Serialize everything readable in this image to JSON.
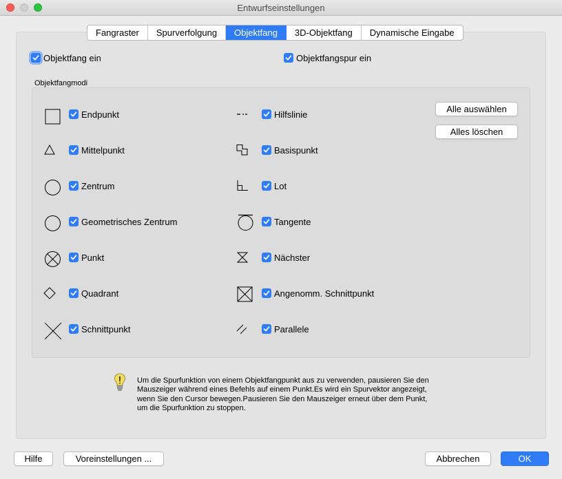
{
  "window": {
    "title": "Entwurfseinstellungen"
  },
  "tabs": [
    {
      "label": "Fangraster",
      "active": false
    },
    {
      "label": "Spurverfolgung",
      "active": false
    },
    {
      "label": "Objektfang",
      "active": true
    },
    {
      "label": "3D-Objektfang",
      "active": false
    },
    {
      "label": "Dynamische Eingabe",
      "active": false
    }
  ],
  "options": {
    "objektfang_ein": {
      "label": "Objektfang ein",
      "checked": true
    },
    "objektfangspur_ein": {
      "label": "Objektfangspur ein",
      "checked": true
    }
  },
  "modes": {
    "section_label": "Objektfangmodi",
    "left": [
      {
        "label": "Endpunkt",
        "icon": "endpoint-square-icon",
        "checked": true
      },
      {
        "label": "Mittelpunkt",
        "icon": "midpoint-triangle-icon",
        "checked": true
      },
      {
        "label": "Zentrum",
        "icon": "center-circle-icon",
        "checked": true
      },
      {
        "label": "Geometrisches Zentrum",
        "icon": "geometric-center-circle-icon",
        "checked": true
      },
      {
        "label": "Punkt",
        "icon": "node-point-icon",
        "checked": true
      },
      {
        "label": "Quadrant",
        "icon": "quadrant-diamond-icon",
        "checked": true
      },
      {
        "label": "Schnittpunkt",
        "icon": "intersection-x-icon",
        "checked": true
      }
    ],
    "right": [
      {
        "label": "Hilfslinie",
        "icon": "extension-line-icon",
        "checked": true
      },
      {
        "label": "Basispunkt",
        "icon": "insertion-point-icon",
        "checked": true
      },
      {
        "label": "Lot",
        "icon": "perpendicular-icon",
        "checked": true
      },
      {
        "label": "Tangente",
        "icon": "tangent-icon",
        "checked": true
      },
      {
        "label": "Nächster",
        "icon": "nearest-hourglass-icon",
        "checked": true
      },
      {
        "label": "Angenomm. Schnittpunkt",
        "icon": "apparent-intersection-icon",
        "checked": true
      },
      {
        "label": "Parallele",
        "icon": "parallel-icon",
        "checked": true
      }
    ],
    "select_all_label": "Alle auswählen",
    "clear_all_label": "Alles löschen"
  },
  "info": {
    "icon": "lightbulb-icon",
    "lines": [
      "Um die Spurfunktion von einem Objektfangpunkt aus zu verwenden, pausieren Sie den",
      "Mauszeiger während eines Befehls auf einem Punkt.Es wird ein Spurvektor angezeigt,",
      "wenn Sie den Cursor bewegen.Pausieren Sie den Mauszeiger erneut über dem Punkt,",
      "um die Spurfunktion zu stoppen."
    ]
  },
  "footer": {
    "help_label": "Hilfe",
    "presets_label": "Voreinstellungen ...",
    "cancel_label": "Abbrechen",
    "ok_label": "OK"
  },
  "colors": {
    "accent": "#2f7cf6"
  }
}
